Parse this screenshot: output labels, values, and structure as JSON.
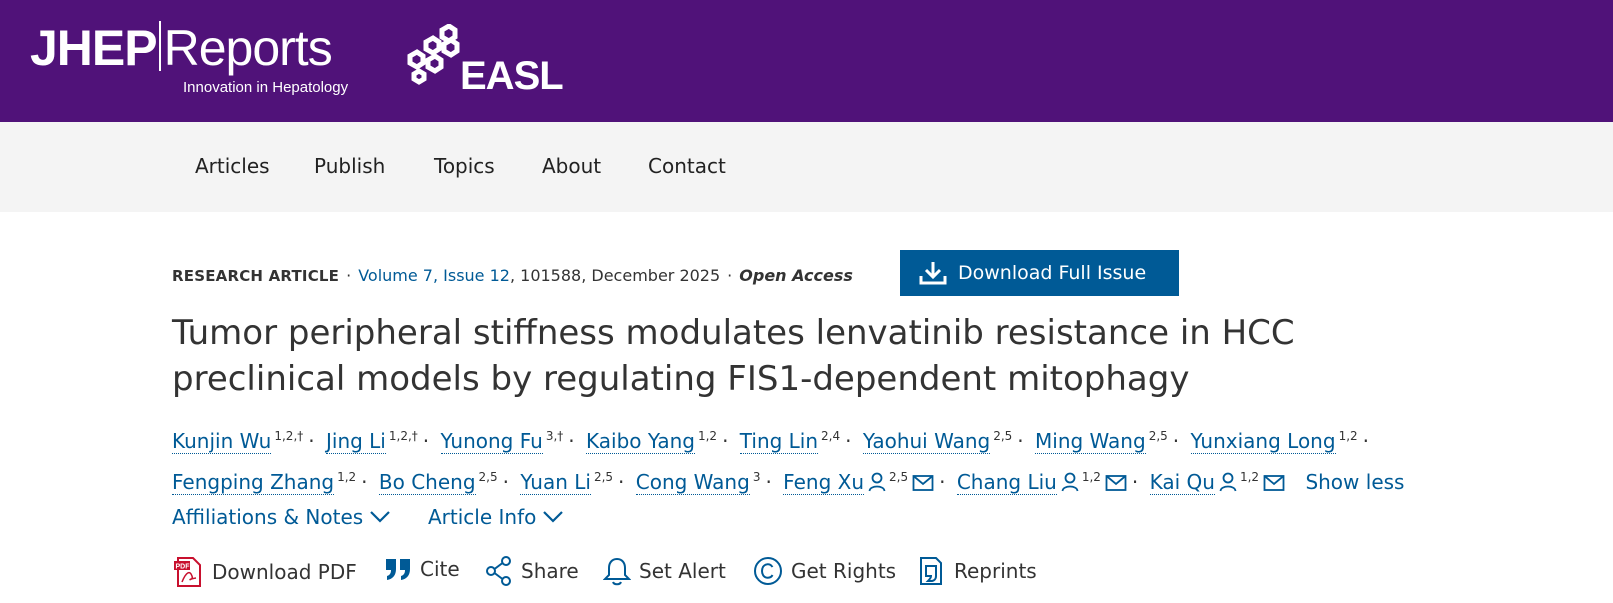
{
  "header": {
    "logo_bold": "JHEP",
    "logo_light": "Reports",
    "logo_tagline": "Innovation in Hepatology",
    "partner_logo": "EASL",
    "bg_color": "#501279"
  },
  "nav": {
    "items": [
      "Articles",
      "Publish",
      "Topics",
      "About",
      "Contact"
    ]
  },
  "meta": {
    "article_type": "RESEARCH ARTICLE",
    "volume_issue": "Volume 7, Issue 12",
    "article_number_date": "101588, December 2025",
    "access": "Open Access",
    "download_issue_label": "Download Full Issue",
    "accent_color": "#005a96"
  },
  "title": "Tumor peripheral stiffness modulates lenvatinib resistance in HCC preclinical models by regulating FIS1-dependent mitophagy",
  "authors": [
    {
      "name": "Kunjin Wu",
      "sup": "1,2,†"
    },
    {
      "name": "Jing Li",
      "sup": "1,2,†"
    },
    {
      "name": "Yunong Fu",
      "sup": "3,†"
    },
    {
      "name": "Kaibo Yang",
      "sup": "1,2"
    },
    {
      "name": "Ting Lin",
      "sup": "2,4"
    },
    {
      "name": "Yaohui Wang",
      "sup": "2,5"
    },
    {
      "name": "Ming Wang",
      "sup": "2,5"
    },
    {
      "name": "Yunxiang Long",
      "sup": "1,2"
    },
    {
      "name": "Fengping Zhang",
      "sup": "1,2"
    },
    {
      "name": "Bo Cheng",
      "sup": "2,5"
    },
    {
      "name": "Yuan Li",
      "sup": "2,5"
    },
    {
      "name": "Cong Wang",
      "sup": "3"
    },
    {
      "name": "Feng Xu",
      "sup": "2,5",
      "corresponding": true
    },
    {
      "name": "Chang Liu",
      "sup": "1,2",
      "corresponding": true
    },
    {
      "name": "Kai Qu",
      "sup": "1,2",
      "corresponding": true
    }
  ],
  "show_less_label": "Show less",
  "expanders": {
    "affiliations": "Affiliations & Notes",
    "article_info": "Article Info"
  },
  "tools": {
    "download_pdf": "Download PDF",
    "cite": "Cite",
    "share": "Share",
    "set_alert": "Set Alert",
    "get_rights": "Get Rights",
    "reprints": "Reprints"
  }
}
